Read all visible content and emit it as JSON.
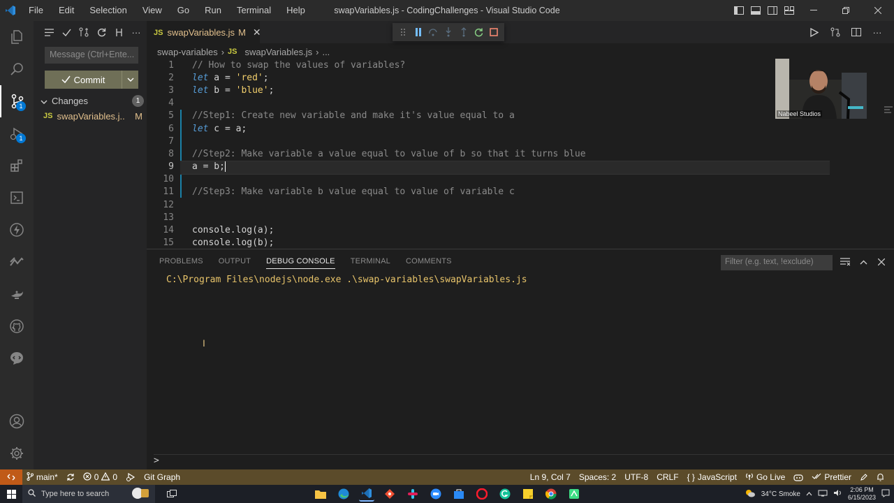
{
  "window": {
    "title": "swapVariables.js - CodingChallenges - Visual Studio Code"
  },
  "menu": [
    "File",
    "Edit",
    "Selection",
    "View",
    "Go",
    "Run",
    "Terminal",
    "Help"
  ],
  "sidebar": {
    "message_placeholder": "Message (Ctrl+Ente...",
    "commit_label": "Commit",
    "changes_label": "Changes",
    "changes_count": "1",
    "file": {
      "name": "swapVariables.j...",
      "status": "M",
      "lang": "JS"
    }
  },
  "activity_badges": {
    "scm": "1",
    "debug": "1"
  },
  "editor": {
    "tab": {
      "lang": "JS",
      "name": "swapVariables.js",
      "status": "M"
    },
    "breadcrumb": {
      "folder": "swap-variables",
      "lang": "JS",
      "file": "swapVariables.js",
      "more": "..."
    },
    "current_line": 9,
    "line_numbers": [
      "1",
      "2",
      "3",
      "4",
      "5",
      "6",
      "7",
      "8",
      "9",
      "10",
      "11",
      "12",
      "13",
      "14",
      "15"
    ],
    "lines": {
      "l1": "// How to swap the values of variables?",
      "l2_kw": "let",
      "l2_rest": " a = ",
      "l2_str": "'red'",
      "l2_end": ";",
      "l3_kw": "let",
      "l3_rest": " b = ",
      "l3_str": "'blue'",
      "l3_end": ";",
      "l5": "//Step1: Create new variable and make it's value equal to a",
      "l6_kw": "let",
      "l6_rest": " c = a;",
      "l8": "//Step2: Make variable a value equal to value of b so that it turns blue",
      "l9": "a = b;",
      "l11": "//Step3: Make variable b value equal to value of variable c",
      "l14": "console.log(a);",
      "l15": "console.log(b);"
    }
  },
  "webcam": {
    "label": "Nabeel Studios"
  },
  "panel": {
    "tabs": [
      "PROBLEMS",
      "OUTPUT",
      "DEBUG CONSOLE",
      "TERMINAL",
      "COMMENTS"
    ],
    "active_tab": "DEBUG CONSOLE",
    "filter_placeholder": "Filter (e.g. text, !exclude)",
    "output": "C:\\Program Files\\nodejs\\node.exe .\\swap-variables\\swapVariables.js",
    "prompt": ">"
  },
  "statusbar": {
    "branch": "main*",
    "errors": "0",
    "warnings": "0",
    "git_graph": "Git Graph",
    "position": "Ln 9, Col 7",
    "spaces": "Spaces: 2",
    "encoding": "UTF-8",
    "eol": "CRLF",
    "language": "JavaScript",
    "go_live": "Go Live",
    "prettier": "Prettier"
  },
  "taskbar": {
    "search_placeholder": "Type here to search",
    "weather": "34°C Smoke",
    "time": "2:06 PM",
    "date": "6/15/2023"
  },
  "colors": {
    "statusbar": "#5b4b2a",
    "remote": "#c05a18",
    "accent": "#0078d4"
  }
}
